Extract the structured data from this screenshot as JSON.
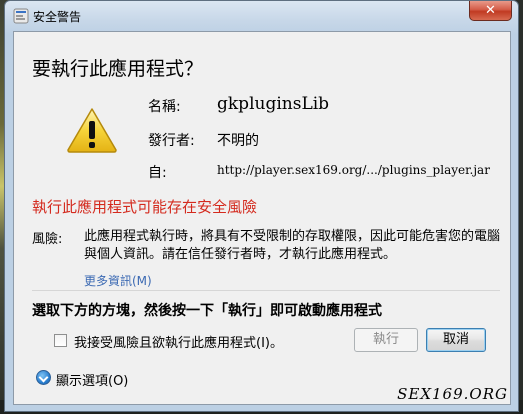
{
  "window": {
    "title": "安全警告",
    "close_label": "✕"
  },
  "dialog": {
    "heading": "要執行此應用程式？",
    "name_label": "名稱:",
    "name_value": "gkpluginsLib",
    "publisher_label": "發行者:",
    "publisher_value": "不明的",
    "from_label": "自:",
    "from_value": "http://player.sex169.org/.../plugins_player.jar",
    "risk_title": "執行此應用程式可能存在安全風險",
    "risk_label": "風險:",
    "risk_text": "此應用程式執行時，將具有不受限制的存取權限，因此可能危害您的電腦與個人資訊。請在信任發行者時，才執行此應用程式。",
    "more_info": "更多資訊(M)",
    "instruction": "選取下方的方塊，然後按一下「執行」即可啟動應用程式",
    "accept_checkbox": "我接受風險且欲執行此應用程式(I)。",
    "accept_checked": false,
    "run_button": "執行",
    "cancel_button": "取消",
    "show_options": "顯示選項(O)"
  },
  "watermark": "SEX169.ORG",
  "colors": {
    "risk_title": "#d42a1e",
    "link": "#3c6ab3",
    "close_button": "#c03a22"
  },
  "icons": {
    "warning": "warning-triangle-icon",
    "title": "shield-icon",
    "options": "chevron-down-circle-icon"
  }
}
